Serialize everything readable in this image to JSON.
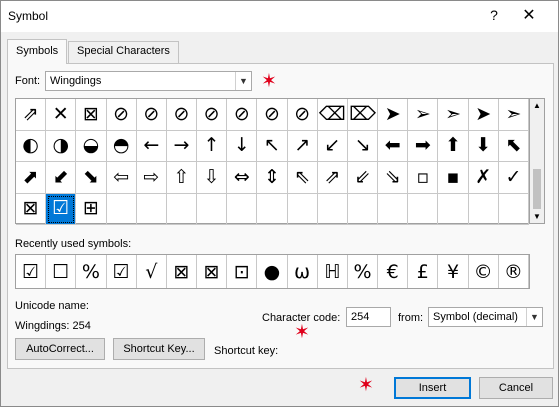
{
  "window": {
    "title": "Symbol",
    "help_glyph": "?",
    "close_glyph": "✕"
  },
  "tabs": [
    {
      "label": "Symbols",
      "active": true
    },
    {
      "label": "Special Characters",
      "active": false
    }
  ],
  "font": {
    "label": "Font:",
    "value": "Wingdings"
  },
  "symbol_grid": {
    "cells": [
      "⇗",
      "✕",
      "⊠",
      "⊘",
      "⊘",
      "⊘",
      "⊘",
      "⊘",
      "⊘",
      "⊘",
      "⌫",
      "⌦",
      "➤",
      "➢",
      "➣",
      "➤",
      "➣",
      "◐",
      "◑",
      "◒",
      "◓",
      "←",
      "→",
      "↑",
      "↓",
      "↖",
      "↗",
      "↙",
      "↘",
      "⬅",
      "➡",
      "⬆",
      "⬇",
      "⬉",
      "⬈",
      "⬋",
      "⬊",
      "⇦",
      "⇨",
      "⇧",
      "⇩",
      "⇔",
      "⇕",
      "⇖",
      "⇗",
      "⇙",
      "⇘",
      "▫",
      "▪",
      "✗",
      "✓",
      "⊠",
      "☑",
      "⊞",
      "",
      "",
      "",
      "",
      "",
      "",
      "",
      "",
      "",
      "",
      "",
      "",
      "",
      ""
    ],
    "selected_index": 52
  },
  "recent": {
    "label": "Recently used symbols:",
    "items": [
      "☑",
      "☐",
      "%",
      "☑",
      "√",
      "⊠",
      "⊠",
      "⊡",
      "●",
      "ω",
      "ℍ",
      "%",
      "€",
      "£",
      "¥",
      "©",
      "®"
    ]
  },
  "unicode": {
    "label": "Unicode name:",
    "value": "Wingdings: 254"
  },
  "char_code": {
    "label": "Character code:",
    "value": "254"
  },
  "from": {
    "label": "from:",
    "value": "Symbol (decimal)"
  },
  "buttons": {
    "autocorrect": "AutoCorrect...",
    "shortcut": "Shortcut Key...",
    "shortcut_key_label": "Shortcut key:",
    "insert": "Insert",
    "cancel": "Cancel"
  },
  "annotations": {
    "star_glyph": "✶",
    "star_color": "#e0001b"
  },
  "colors": {
    "selection": "#0078d7"
  }
}
